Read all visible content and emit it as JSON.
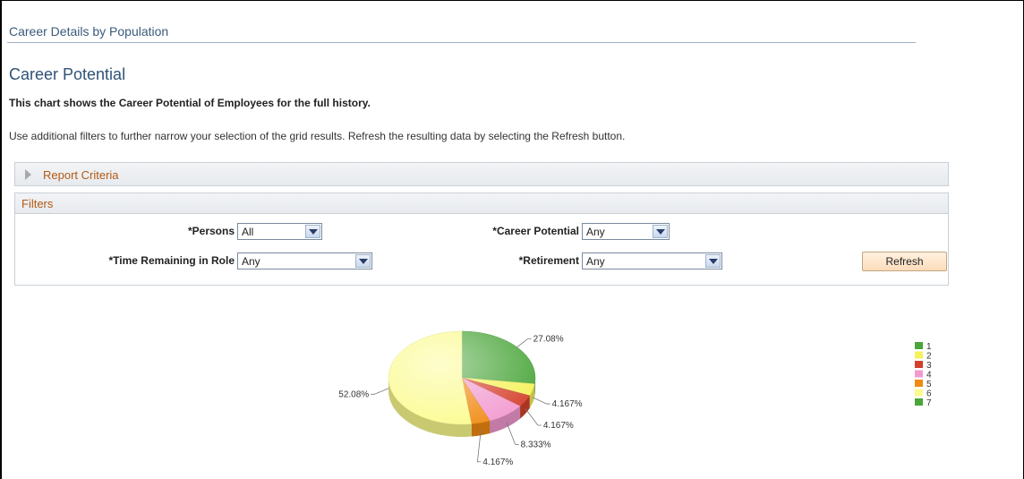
{
  "breadcrumb": "Career Details by Population",
  "page_title": "Career Potential",
  "description_bold": "This chart shows the Career Potential of Employees for the full history.",
  "description": "Use additional filters to further narrow your selection of the grid results. Refresh the resulting data by selecting the Refresh button.",
  "report_criteria": {
    "label": "Report Criteria"
  },
  "filters": {
    "header": "Filters",
    "persons": {
      "label": "*Persons",
      "value": "All"
    },
    "career_potential": {
      "label": "*Career Potential",
      "value": "Any"
    },
    "time_remaining": {
      "label": "*Time Remaining in Role",
      "value": "Any"
    },
    "retirement": {
      "label": "*Retirement",
      "value": "Any"
    },
    "refresh_label": "Refresh"
  },
  "chart_data": {
    "type": "pie",
    "title": "",
    "series": [
      {
        "name": "1",
        "value": 27.08,
        "label": "27.08%",
        "color": "#4aa53a"
      },
      {
        "name": "2",
        "value": 4.167,
        "label": "4.167%",
        "color": "#f5f25a"
      },
      {
        "name": "3",
        "value": 4.167,
        "label": "4.167%",
        "color": "#d4402b"
      },
      {
        "name": "4",
        "value": 8.333,
        "label": "8.333%",
        "color": "#f29ad0"
      },
      {
        "name": "5",
        "value": 4.167,
        "label": "4.167%",
        "color": "#f08a12"
      },
      {
        "name": "6",
        "value": 52.08,
        "label": "52.08%",
        "color": "#fbfb8e"
      }
    ],
    "legend": [
      "1",
      "2",
      "3",
      "4",
      "5",
      "6",
      "7"
    ],
    "legend_colors": [
      "#4aa53a",
      "#f5f25a",
      "#d4402b",
      "#f29ad0",
      "#f08a12",
      "#fbfb8e",
      "#4aa53a"
    ],
    "legend_position": "right"
  }
}
